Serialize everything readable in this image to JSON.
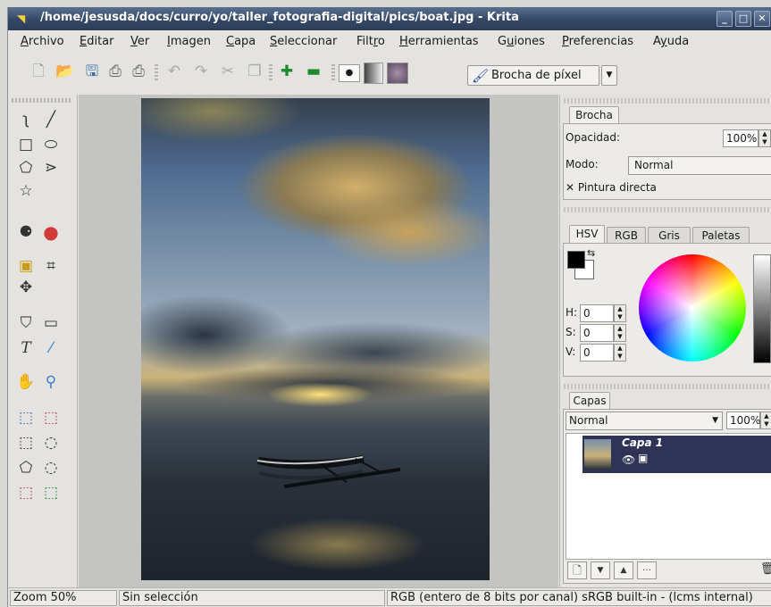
{
  "window": {
    "title": "/home/jesusda/docs/curro/yo/taller_fotografia-digital/pics/boat.jpg - Krita",
    "app_icon": "krita-icon",
    "controls": [
      "minimize-icon",
      "maximize-icon",
      "close-icon"
    ]
  },
  "menu": [
    {
      "accel": "A",
      "rest": "rchivo"
    },
    {
      "accel": "E",
      "rest": "ditar"
    },
    {
      "accel": "V",
      "rest": "er"
    },
    {
      "accel": "I",
      "rest": "magen"
    },
    {
      "accel": "C",
      "rest": "apa"
    },
    {
      "accel": "S",
      "rest": "eleccionar"
    },
    {
      "pre": "Filt",
      "accel": "r",
      "rest": "o"
    },
    {
      "accel": "H",
      "rest": "erramientas"
    },
    {
      "pre": "G",
      "accel": "u",
      "rest": "iones"
    },
    {
      "accel": "P",
      "rest": "referencias"
    },
    {
      "pre": "A",
      "accel": "y",
      "rest": "uda"
    }
  ],
  "toolbar": {
    "brush_label": "Brocha de píxel"
  },
  "brush_panel": {
    "tab": "Brocha",
    "opacity_label": "Opacidad:",
    "opacity_value": "100%",
    "mode_label": "Modo:",
    "mode_value": "Normal",
    "direct_paint_label": "Pintura directa",
    "direct_paint_checked": true
  },
  "color_panel": {
    "tabs": [
      "HSV",
      "RGB",
      "Gris",
      "Paletas"
    ],
    "active_tab": "HSV",
    "h_label": "H:",
    "h_value": "0",
    "s_label": "S:",
    "s_value": "0",
    "v_label": "V:",
    "v_value": "0",
    "foreground": "#000000",
    "background": "#ffffff"
  },
  "layers_panel": {
    "tab": "Capas",
    "mode_value": "Normal",
    "opacity_value": "100%",
    "layers": [
      {
        "name": "Capa 1",
        "selected": true
      }
    ],
    "selected_color": "#2f3457"
  },
  "status": {
    "zoom": "Zoom 50%",
    "selection": "Sin selección",
    "color_info": "RGB (entero de 8 bits por canal)  sRGB built-in - (lcms internal)"
  }
}
